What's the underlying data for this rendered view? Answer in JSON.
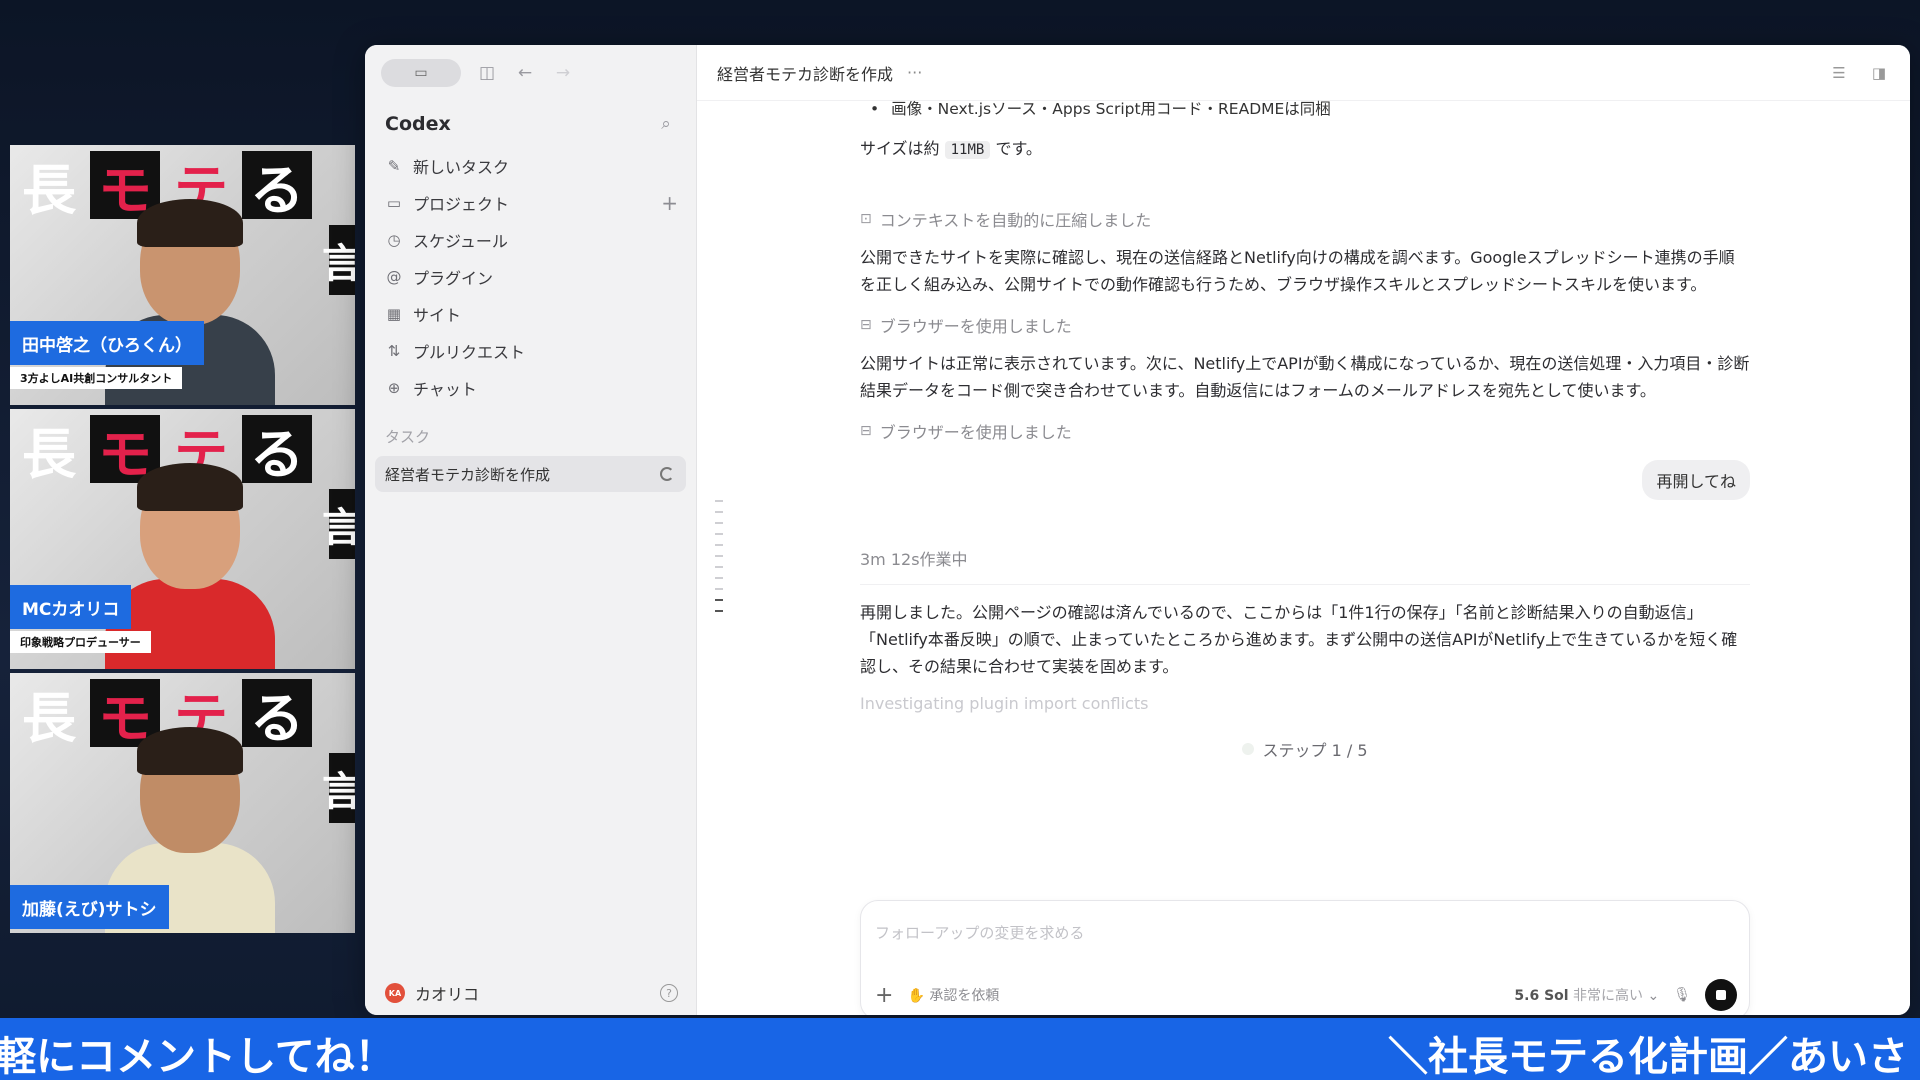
{
  "participants": [
    {
      "name": "田中啓之（ひろくん）",
      "role": "3方よしAI共創コンサルタント",
      "shirt": "#37404a",
      "skin": "#c9946f"
    },
    {
      "name": "MCカオリコ",
      "role": "印象戦略プロデューサー",
      "shirt": "#d9292b",
      "skin": "#d8a07c"
    },
    {
      "name": "加藤(えび)サトシ",
      "role": "",
      "shirt": "#e9e3c8",
      "skin": "#c08c66"
    }
  ],
  "poster": {
    "chars": [
      "長",
      "モ",
      "テ",
      "る"
    ],
    "side": "言"
  },
  "sidebar": {
    "brand": "Codex",
    "nav": [
      {
        "label": "新しいタスク",
        "icon": "edit-icon",
        "glyph": "✎"
      },
      {
        "label": "プロジェクト",
        "icon": "folder-icon",
        "glyph": "▭"
      },
      {
        "label": "スケジュール",
        "icon": "clock-icon",
        "glyph": "◷"
      },
      {
        "label": "プラグイン",
        "icon": "at-icon",
        "glyph": "@"
      },
      {
        "label": "サイト",
        "icon": "grid-icon",
        "glyph": "▦"
      },
      {
        "label": "プルリクエスト",
        "icon": "pull-request-icon",
        "glyph": "⇅"
      },
      {
        "label": "チャット",
        "icon": "chat-icon",
        "glyph": "⊕"
      }
    ],
    "section": "タスク",
    "task": "経営者モテカ診断を作成",
    "user": {
      "initials": "KA",
      "name": "カオリコ"
    }
  },
  "header": {
    "title": "経営者モテカ診断を作成",
    "more": "···"
  },
  "messages": {
    "bullet": "画像・Next.jsソース・Apps Script用コード・READMEは同梱",
    "size_prefix": "サイズは約",
    "size_value": "11MB",
    "size_suffix": "です。",
    "status_compress": "コンテキストを自動的に圧縮しました",
    "para1": "公開できたサイトを実際に確認し、現在の送信経路とNetlify向けの構成を調べます。Googleスプレッドシート連携の手順を正しく組み込み、公開サイトでの動作確認も行うため、ブラウザ操作スキルとスプレッドシートスキルを使います。",
    "status_browser1": "ブラウザーを使用しました",
    "para2": "公開サイトは正常に表示されています。次に、Netlify上でAPIが動く構成になっているか、現在の送信処理・入力項目・診断結果データをコード側で突き合わせています。自動返信にはフォームのメールアドレスを宛先として使います。",
    "status_browser2": "ブラウザーを使用しました",
    "user_msg": "再開してね",
    "working": "3m 12s作業中",
    "para3": "再開しました。公開ページの確認は済んでいるので、ここからは「1件1行の保存」「名前と診断結果入りの自動返信」「Netlify本番反映」の順で、止まっていたところから進めます。まず公開中の送信APIがNetlify上で生きているかを短く確認し、その結果に合わせて実装を固めます。",
    "faint_status": "Investigating plugin import conflicts",
    "step": "ステップ 1 / 5"
  },
  "composer": {
    "placeholder": "フォローアップの変更を求める",
    "approval": "承認を依頼",
    "model": "5.6 Sol",
    "effort": "非常に高い"
  },
  "ticker": {
    "left": "軽にコメントしてね！",
    "right": "＼社長モテる化計画／あいさ"
  }
}
